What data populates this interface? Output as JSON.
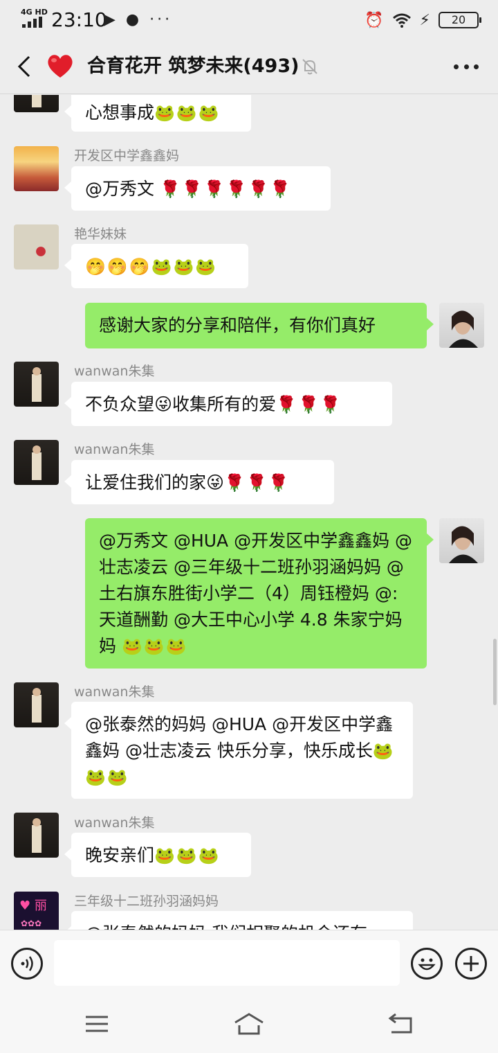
{
  "status_bar": {
    "network": "4G HD",
    "time": "23:10",
    "app_icons": "▶ ● ···",
    "battery": "20"
  },
  "header": {
    "back_icon": "chevron-left-icon",
    "group_icon": "red-heart-icon",
    "title": "合育花开 筑梦未来(493)",
    "mute_icon": "bell-muted-icon",
    "more_icon": "more-dots-icon"
  },
  "messages": [
    {
      "side": "in",
      "sender": "",
      "text": "心想事成",
      "emoji": "🐸🐸🐸"
    },
    {
      "side": "in",
      "sender": "开发区中学鑫鑫妈",
      "text": "@万秀文 ",
      "emoji": "🌹🌹🌹🌹🌹🌹"
    },
    {
      "side": "in",
      "sender": "艳华妹妹",
      "text": "",
      "emoji": "🤭🤭🤭🐸🐸🐸"
    },
    {
      "side": "out",
      "text": "感谢大家的分享和陪伴，有你们真好",
      "emoji": ""
    },
    {
      "side": "in",
      "sender": "wanwan朱集",
      "text": "不负众望😜收集所有的爱",
      "emoji": "🌹🌹🌹"
    },
    {
      "side": "in",
      "sender": "wanwan朱集",
      "text": "让爱住我们的家😜",
      "emoji": "🌹🌹🌹"
    },
    {
      "side": "out",
      "text": "@万秀文 @HUA @开发区中学鑫鑫妈 @壮志凌云 @三年级十二班孙羽涵妈妈 @土右旗东胜街小学二（4）周钰橙妈 @:天道酬勤 @大王中心小学 4.8 朱家宁妈妈 ",
      "emoji": "🐸🐸🐸"
    },
    {
      "side": "in",
      "sender": "wanwan朱集",
      "text": "@张泰然的妈妈 @HUA @开发区中学鑫鑫妈 @壮志凌云  快乐分享，快乐成长",
      "emoji": "🐸🐸🐸"
    },
    {
      "side": "in",
      "sender": "wanwan朱集",
      "text": "晚安亲们",
      "emoji": "🐸🐸🐸"
    },
    {
      "side": "in",
      "sender": "三年级十二班孙羽涵妈妈",
      "text": "@张泰然的妈妈 我们相聚的机会还有",
      "emoji": ""
    }
  ],
  "input_bar": {
    "voice_icon": "voice-icon",
    "placeholder": "",
    "emoji_icon": "emoji-smile-icon",
    "plus_icon": "plus-icon"
  },
  "nav": {
    "menu_icon": "menu-icon",
    "home_icon": "home-icon",
    "back_icon": "back-icon"
  },
  "colors": {
    "background": "#ededed",
    "bubble_out": "#95ec69",
    "bubble_in": "#ffffff",
    "sender_name": "#888888"
  }
}
